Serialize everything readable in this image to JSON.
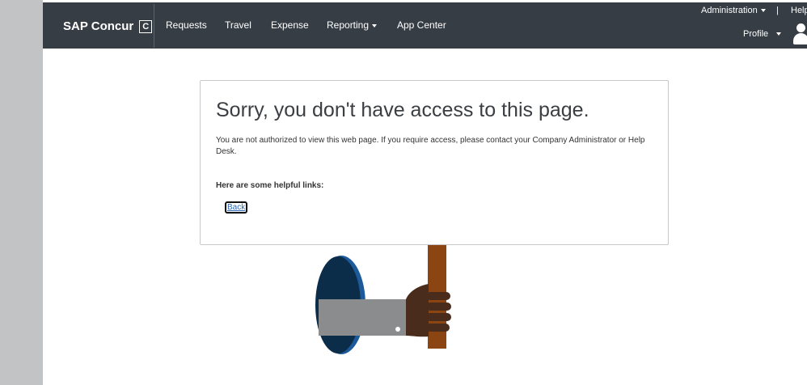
{
  "header": {
    "brand": "SAP Concur",
    "brand_mark": "C",
    "nav": {
      "requests": "Requests",
      "travel": "Travel",
      "expense": "Expense",
      "reporting": "Reporting",
      "app_center": "App Center"
    },
    "utility": {
      "administration": "Administration",
      "separator": "|",
      "help": "Help",
      "profile": "Profile"
    }
  },
  "main": {
    "title": "Sorry, you don't have access to this page.",
    "message": "You are not authorized to view this web page. If you require access, please contact your Company Administrator or Help Desk.",
    "links_heading": "Here are some helpful links:",
    "back_link": "Back"
  },
  "colors": {
    "navbar": "#363d45",
    "gutter": "#c2c3c5",
    "link": "#2a64b4",
    "pole": "#8b4513",
    "sleeve": "#8a8c8e",
    "hand": "#4a2c1c",
    "portal": "#0c2d4a"
  },
  "icons": {
    "reporting_dropdown": "caret-down-icon",
    "administration_dropdown": "caret-down-icon",
    "profile_dropdown": "caret-down-icon",
    "avatar": "user-avatar-icon"
  }
}
